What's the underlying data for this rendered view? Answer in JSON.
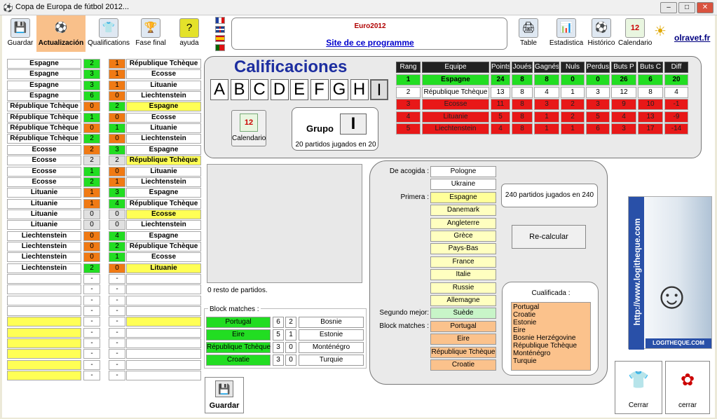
{
  "window": {
    "title": "Copa de Europa de fútbol 2012...",
    "min": "–",
    "max": "□",
    "close": "✕"
  },
  "toolbar": [
    {
      "label": "Guardar",
      "icon": "💾"
    },
    {
      "label": "Actualización",
      "icon": "⚽"
    },
    {
      "label": "Qualifications",
      "icon": "👕"
    },
    {
      "label": "Fase final",
      "icon": "🏆"
    },
    {
      "label": "ayuda",
      "icon": "?"
    }
  ],
  "toolbar_right": [
    {
      "label": "Table",
      "icon": "🖨"
    },
    {
      "label": "Estadistica",
      "icon": "📊"
    },
    {
      "label": "Histórico",
      "icon": "⚽"
    },
    {
      "label": "Calendario",
      "icon": "12"
    }
  ],
  "brand": "olravet.fr",
  "header": {
    "event": "Euro2012",
    "link": "Site de ce programme"
  },
  "matches": [
    {
      "home": "Espagne",
      "hs": "2",
      "as": "1",
      "away": "République Tchèque",
      "hc": "g",
      "ac": "o",
      "ay": false
    },
    {
      "home": "Espagne",
      "hs": "3",
      "as": "1",
      "away": "Ecosse",
      "hc": "g",
      "ac": "o",
      "ay": false
    },
    {
      "home": "Espagne",
      "hs": "3",
      "as": "1",
      "away": "Lituanie",
      "hc": "g",
      "ac": "o",
      "ay": false
    },
    {
      "home": "Espagne",
      "hs": "6",
      "as": "0",
      "away": "Liechtenstein",
      "hc": "g",
      "ac": "o",
      "ay": false
    },
    {
      "home": "République Tchèque",
      "hs": "0",
      "as": "2",
      "away": "Espagne",
      "hc": "o",
      "ac": "g",
      "ay": true
    },
    {
      "home": "République Tchèque",
      "hs": "1",
      "as": "0",
      "away": "Ecosse",
      "hc": "g",
      "ac": "o",
      "ay": false
    },
    {
      "home": "République Tchèque",
      "hs": "0",
      "as": "1",
      "away": "Lituanie",
      "hc": "o",
      "ac": "g",
      "ay": false
    },
    {
      "home": "République Tchèque",
      "hs": "2",
      "as": "0",
      "away": "Liechtenstein",
      "hc": "g",
      "ac": "o",
      "ay": false
    },
    {
      "home": "Ecosse",
      "hs": "2",
      "as": "3",
      "away": "Espagne",
      "hc": "o",
      "ac": "g",
      "ay": false
    },
    {
      "home": "Ecosse",
      "hs": "2",
      "as": "2",
      "away": "République Tchèque",
      "hc": "gr",
      "ac": "gr",
      "ay": true
    },
    {
      "home": "Ecosse",
      "hs": "1",
      "as": "0",
      "away": "Lituanie",
      "hc": "g",
      "ac": "o",
      "ay": false
    },
    {
      "home": "Ecosse",
      "hs": "2",
      "as": "1",
      "away": "Liechtenstein",
      "hc": "g",
      "ac": "o",
      "ay": false
    },
    {
      "home": "Lituanie",
      "hs": "1",
      "as": "3",
      "away": "Espagne",
      "hc": "o",
      "ac": "g",
      "ay": false
    },
    {
      "home": "Lituanie",
      "hs": "1",
      "as": "4",
      "away": "République Tchèque",
      "hc": "o",
      "ac": "g",
      "ay": false
    },
    {
      "home": "Lituanie",
      "hs": "0",
      "as": "0",
      "away": "Ecosse",
      "hc": "gr",
      "ac": "gr",
      "ay": true
    },
    {
      "home": "Lituanie",
      "hs": "0",
      "as": "0",
      "away": "Liechtenstein",
      "hc": "gr",
      "ac": "gr",
      "ay": false
    },
    {
      "home": "Liechtenstein",
      "hs": "0",
      "as": "4",
      "away": "Espagne",
      "hc": "o",
      "ac": "g",
      "ay": false
    },
    {
      "home": "Liechtenstein",
      "hs": "0",
      "as": "2",
      "away": "République Tchèque",
      "hc": "o",
      "ac": "g",
      "ay": false
    },
    {
      "home": "Liechtenstein",
      "hs": "0",
      "as": "1",
      "away": "Ecosse",
      "hc": "o",
      "ac": "g",
      "ay": false
    },
    {
      "home": "Liechtenstein",
      "hs": "2",
      "as": "0",
      "away": "Lituanie",
      "hc": "g",
      "ac": "o",
      "ay": true
    },
    {
      "home": "",
      "hs": "-",
      "as": "-",
      "away": "",
      "hc": "w",
      "ac": "w",
      "ay": false
    },
    {
      "home": "",
      "hs": "-",
      "as": "-",
      "away": "",
      "hc": "w",
      "ac": "w",
      "ay": false
    },
    {
      "home": "",
      "hs": "-",
      "as": "-",
      "away": "",
      "hc": "w",
      "ac": "w",
      "ay": false
    },
    {
      "home": "",
      "hs": "-",
      "as": "-",
      "away": "",
      "hc": "w",
      "ac": "w",
      "ay": false
    },
    {
      "home": "",
      "hs": "-",
      "as": "-",
      "away": "",
      "hc": "w",
      "ac": "w",
      "ay": true
    },
    {
      "home": "",
      "hs": "-",
      "as": "-",
      "away": "",
      "hc": "w",
      "ac": "w",
      "ay": false
    },
    {
      "home": "",
      "hs": "-",
      "as": "-",
      "away": "",
      "hc": "w",
      "ac": "w",
      "ay": false
    },
    {
      "home": "",
      "hs": "-",
      "as": "-",
      "away": "",
      "hc": "w",
      "ac": "w",
      "ay": false
    },
    {
      "home": "",
      "hs": "-",
      "as": "-",
      "away": "",
      "hc": "w",
      "ac": "w",
      "ay": false
    },
    {
      "home": "",
      "hs": "-",
      "as": "-",
      "away": "",
      "hc": "w",
      "ac": "w",
      "ay": false
    }
  ],
  "yellow_home_rows": [
    24,
    25,
    26,
    27,
    28,
    29
  ],
  "calif": {
    "title": "Calificaciones",
    "letters": [
      "A",
      "B",
      "C",
      "D",
      "E",
      "F",
      "G",
      "H",
      "I"
    ],
    "selected": "I",
    "calendar_label": "Calendario",
    "grupo_label": "Grupo",
    "grupo_value": "I",
    "played": "20 partidos jugados en 20"
  },
  "standings": {
    "headers": [
      "Rang",
      "Equipe",
      "Points",
      "Joués",
      "Gagnés",
      "Nuls",
      "Perdus",
      "Buts P",
      "Buts C",
      "Diff"
    ],
    "rows": [
      {
        "c": "rg",
        "v": [
          "1",
          "Espagne",
          "24",
          "8",
          "8",
          "0",
          "0",
          "26",
          "6",
          "20"
        ]
      },
      {
        "c": "rw",
        "v": [
          "2",
          "République Tchèque",
          "13",
          "8",
          "4",
          "1",
          "3",
          "12",
          "8",
          "4"
        ]
      },
      {
        "c": "rr",
        "v": [
          "3",
          "Ecosse",
          "11",
          "8",
          "3",
          "2",
          "3",
          "9",
          "10",
          "-1"
        ]
      },
      {
        "c": "rr",
        "v": [
          "4",
          "Lituanie",
          "5",
          "8",
          "1",
          "2",
          "5",
          "4",
          "13",
          "-9"
        ]
      },
      {
        "c": "rr",
        "v": [
          "5",
          "Liechtenstein",
          "4",
          "8",
          "1",
          "1",
          "6",
          "3",
          "17",
          "-14"
        ]
      }
    ]
  },
  "remaining": "0 resto de partidos.",
  "block": {
    "title": "Block matches :",
    "rows": [
      {
        "home": "Portugal",
        "hs": "6",
        "as": "2",
        "away": "Bosnie"
      },
      {
        "home": "Eire",
        "hs": "5",
        "as": "1",
        "away": "Estonie"
      },
      {
        "home": "République Tchèque",
        "hs": "3",
        "as": "0",
        "away": "Monténégro"
      },
      {
        "home": "Croatie",
        "hs": "3",
        "as": "0",
        "away": "Turquie"
      }
    ]
  },
  "qual": {
    "acogida_label": "De acogida :",
    "acogida": [
      "Pologne",
      "Ukraine"
    ],
    "primera_label": "Primera :",
    "primera": [
      "Espagne",
      "Danemark",
      "Angleterre",
      "Grèce",
      "Pays-Bas",
      "France",
      "Italie",
      "Russie",
      "Allemagne"
    ],
    "segundo_label": "Segundo mejor:",
    "segundo": "Suède",
    "block_label": "Block matches :",
    "block": [
      "Portugal",
      "Eire",
      "République Tchèque",
      "Croatie"
    ],
    "played": "240 partidos jugados en 240",
    "recalc": "Re-calcular",
    "qualified_title": "Cualificada :",
    "qualified": [
      "Portugal",
      "Croatie",
      "Estonie",
      "Eire",
      "Bosnie Herzégovine",
      "République Tchèque",
      "Monténégro",
      "Turquie"
    ]
  },
  "ad": {
    "text": "http://www.logitheque.com",
    "foot": "LOGITHEQUE.COM"
  },
  "bottom": {
    "save": "Guardar",
    "cerrar1": "Cerrar",
    "cerrar2": "cerrar"
  },
  "colors": {
    "green": "#22dd22",
    "orange": "#f07a14",
    "red": "#e81818",
    "yellow": "#ffff55",
    "peach": "#fbc28c",
    "title_blue": "#1d2ea0"
  }
}
